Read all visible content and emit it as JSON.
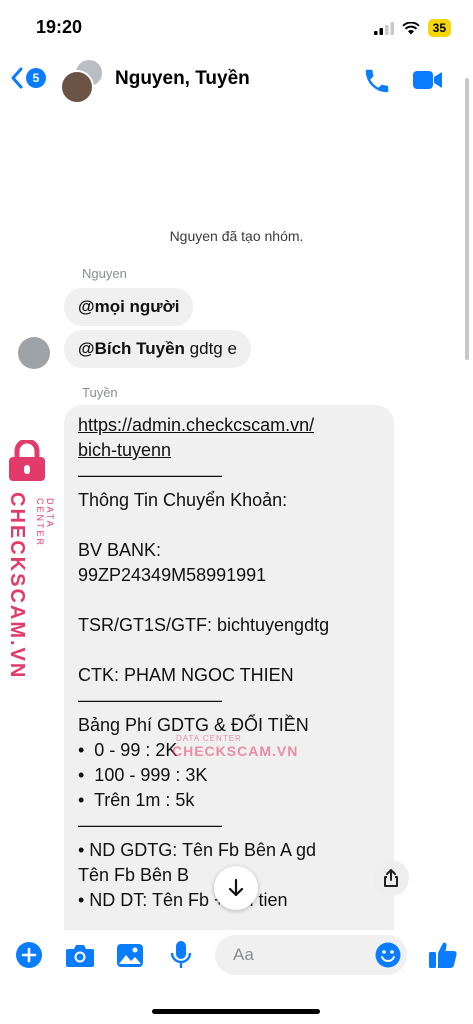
{
  "status_bar": {
    "time": "19:20",
    "battery": "35"
  },
  "header": {
    "back_count": "5",
    "title": "Nguyen, Tuyền"
  },
  "messages": {
    "system": "Nguyen đã tạo nhóm.",
    "sender_1": "Nguyen",
    "bubble_1": "@mọi người",
    "bubble_2_mention": "@Bích Tuyền",
    "bubble_2_text": " gdtg e",
    "sender_2": "Tuyền",
    "long_message": {
      "lines": [
        "https://admin.checkcscam.vn/",
        "bich-tuyenn",
        "————————",
        "Thông Tin Chuyển Khoản:",
        "",
        "BV BANK:",
        "99ZP24349M58991991",
        "",
        "TSR/GT1S/GTF: bichtuyengdtg",
        "",
        "CTK: PHAM NGOC THIEN",
        "————————",
        "Bảng Phí GDTG & ĐỔI TIỀN",
        "•  0 - 99 : 2K",
        "•  100 - 999 : 3K",
        "•  Trên 1m : 5k",
        "————————",
        "• ND GDTG: Tên Fb Bên A gd",
        "Tên Fb Bên B",
        "• ND DT: Tên Fb + đổi tien"
      ]
    }
  },
  "watermark": {
    "brand": "CHECKSCAM.VN",
    "tagline": "DATA CENTER"
  },
  "composer": {
    "placeholder": "Aa"
  },
  "icons": [
    "back-chevron-icon",
    "phone-icon",
    "video-icon",
    "share-icon",
    "arrow-down-icon",
    "plus-icon",
    "camera-icon",
    "image-icon",
    "mic-icon",
    "emoji-icon",
    "thumbs-up-icon",
    "lock-icon"
  ],
  "colors": {
    "accent": "#0a7cff",
    "bubble": "#f0f0f0",
    "watermark": "#e23a6b"
  }
}
